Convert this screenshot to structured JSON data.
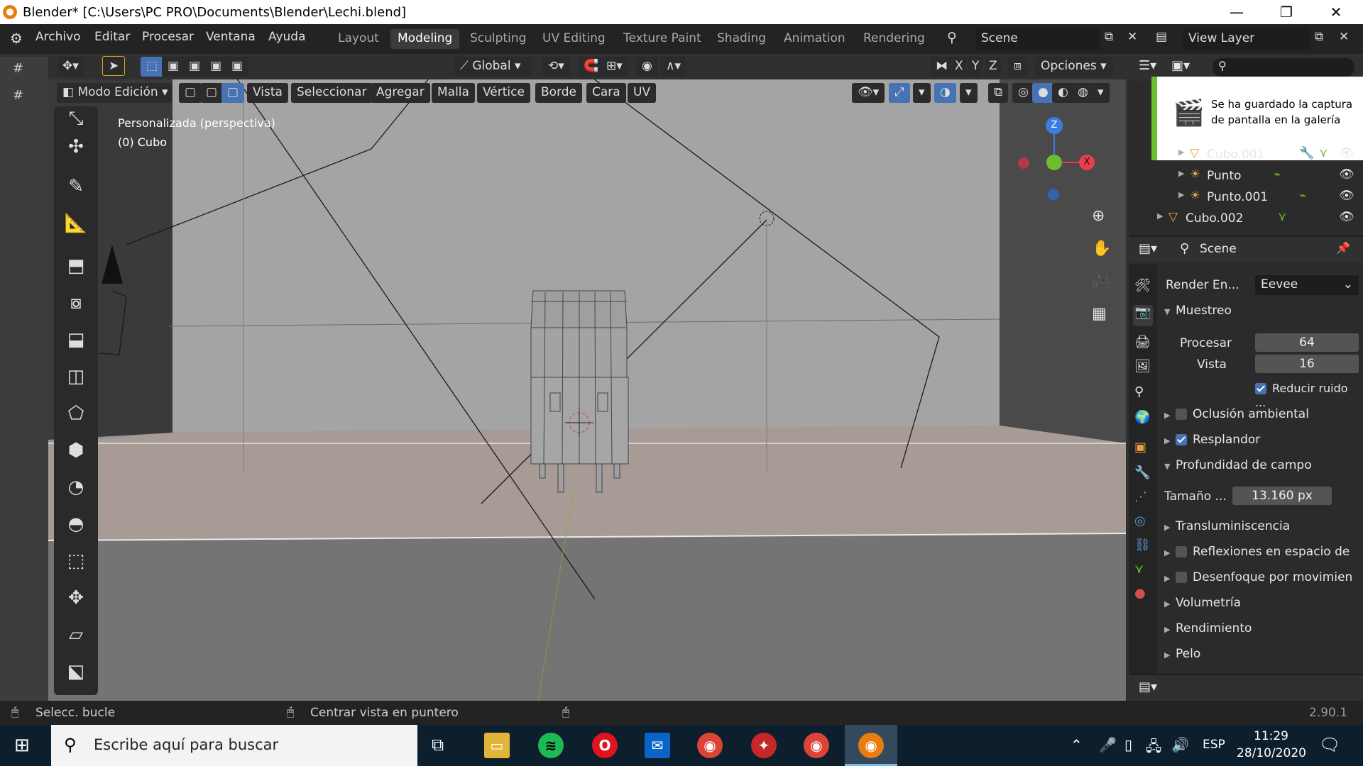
{
  "window": {
    "title": "Blender* [C:\\Users\\PC PRO\\Documents\\Blender\\Lechi.blend]",
    "minimize": "—",
    "restore": "❐",
    "close": "✕"
  },
  "menu": {
    "items": [
      "Archivo",
      "Editar",
      "Procesar",
      "Ventana",
      "Ayuda"
    ]
  },
  "workspaces": [
    "Layout",
    "Modeling",
    "Sculpting",
    "UV Editing",
    "Texture Paint",
    "Shading",
    "Animation",
    "Rendering"
  ],
  "scene": {
    "name": "Scene"
  },
  "view_layer": {
    "name": "View Layer"
  },
  "header": {
    "orientation": "Global",
    "options": "Opciones",
    "axes": [
      "X",
      "Y",
      "Z"
    ]
  },
  "viewport_header": {
    "mode": "Modo Edición",
    "menus": [
      "Vista",
      "Seleccionar",
      "Agregar",
      "Malla",
      "Vértice",
      "Borde",
      "Cara",
      "UV"
    ]
  },
  "viewport": {
    "view_label": "Personalizada (perspectiva)",
    "object_label": "(0) Cubo",
    "gizmo_axes": [
      "Z",
      "X"
    ]
  },
  "notification": {
    "text_line1": "Se ha guardado la captura",
    "text_line2": "de pantalla en la galería"
  },
  "outliner": {
    "items": [
      {
        "name": "Cubo.001"
      },
      {
        "name": "Punto"
      },
      {
        "name": "Punto.001"
      },
      {
        "name": "Cubo.002"
      }
    ]
  },
  "properties": {
    "context": "Scene",
    "render_engine_label": "Render En...",
    "render_engine": "Eevee",
    "sampling": {
      "label": "Muestreo",
      "render_label": "Procesar",
      "render_value": "64",
      "viewport_label": "Vista",
      "viewport_value": "16",
      "denoise_label": "Reducir ruido ...",
      "denoise": true
    },
    "sections": [
      {
        "label": "Oclusión ambiental",
        "checkbox": true,
        "checked": false
      },
      {
        "label": "Resplandor",
        "checkbox": true,
        "checked": true
      },
      {
        "label": "Profundidad de campo",
        "checkbox": false,
        "expanded": true
      }
    ],
    "dof_size_label": "Tamaño ...",
    "dof_size_value": "13.160 px",
    "more_sections": [
      {
        "label": "Transluminiscencia",
        "checkbox": false
      },
      {
        "label": "Reflexiones en espacio de",
        "checkbox": true,
        "checked": false
      },
      {
        "label": "Desenfoque por movimien",
        "checkbox": true,
        "checked": false
      },
      {
        "label": "Volumetría",
        "checkbox": false
      },
      {
        "label": "Rendimiento",
        "checkbox": false
      },
      {
        "label": "Pelo",
        "checkbox": false
      }
    ]
  },
  "statusbar": {
    "left": "Selecc. bucle",
    "middle": "Centrar vista en puntero",
    "version": "2.90.1"
  },
  "taskbar": {
    "search_placeholder": "Escribe aquí para buscar",
    "lang": "ESP",
    "time": "11:29",
    "date": "28/10/2020"
  },
  "colors": {
    "accent": "#4772b3",
    "brand_orange": "#e87d0d",
    "axis_x": "#e8404a",
    "axis_y": "#6cbf2a",
    "axis_z": "#3b7ee0"
  }
}
